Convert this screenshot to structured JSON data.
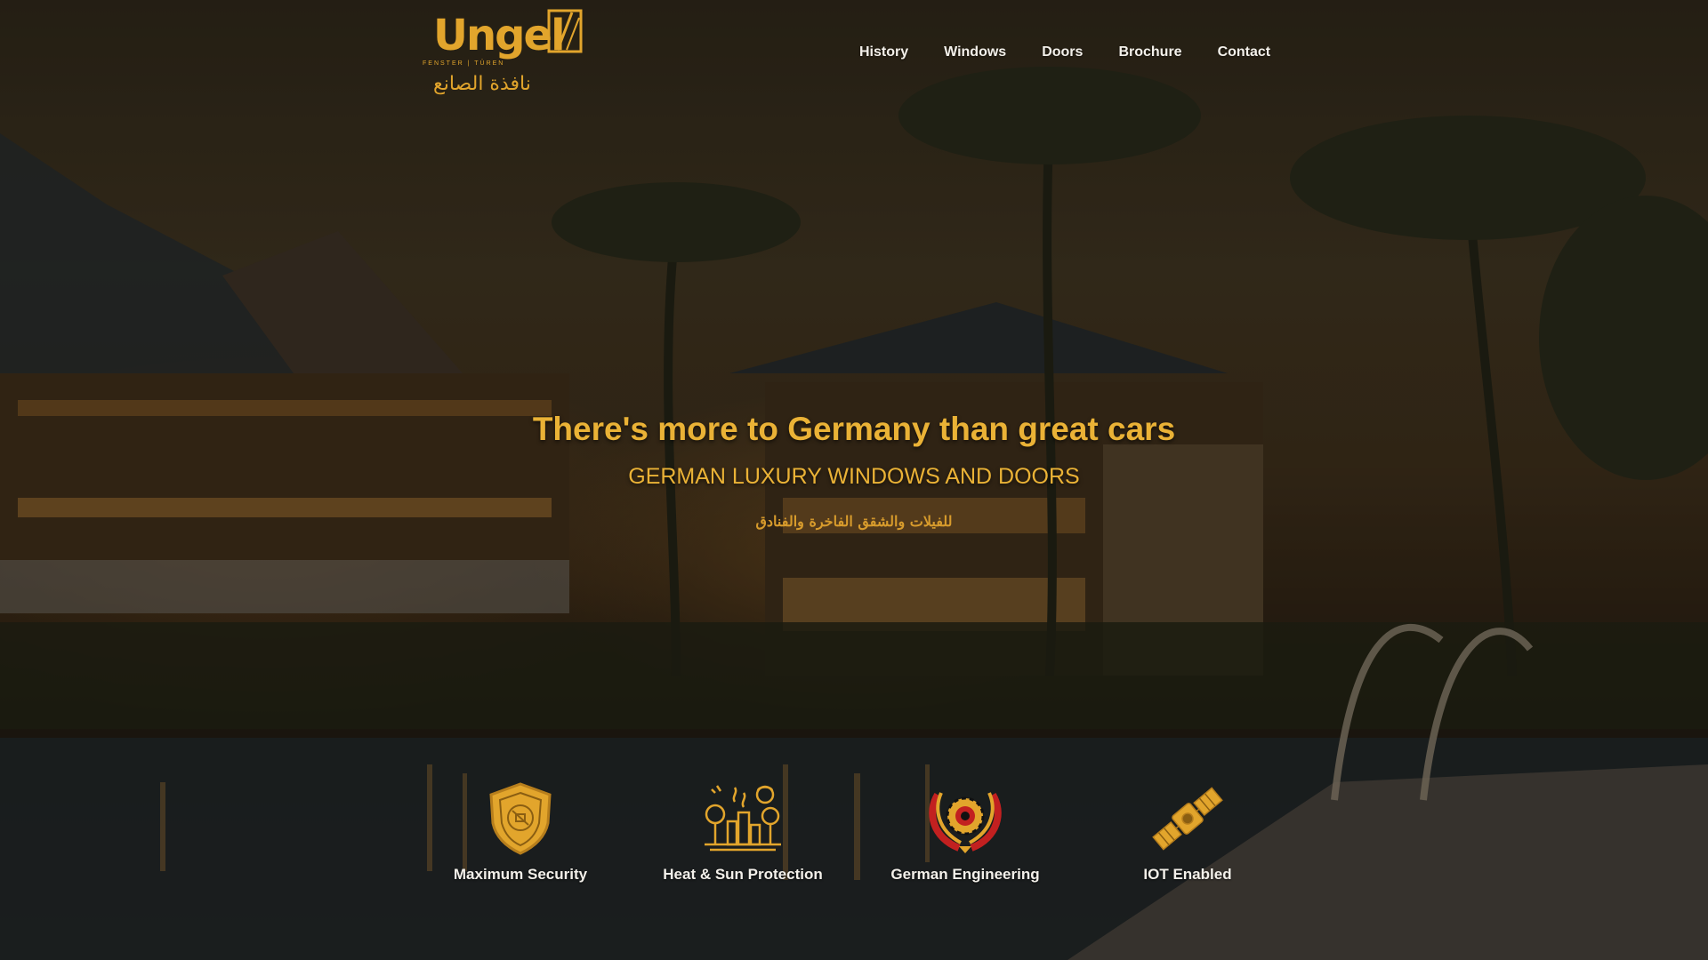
{
  "brand": {
    "logo_text": "Ungel",
    "tagline": "FENSTER | TÜREN",
    "arabic_name": "نافذة الصانع",
    "accent_color": "#e2a52c"
  },
  "nav": {
    "items": [
      {
        "label": "History"
      },
      {
        "label": "Windows"
      },
      {
        "label": "Doors"
      },
      {
        "label": "Brochure"
      },
      {
        "label": "Contact"
      }
    ]
  },
  "hero": {
    "title": "There's more to Germany than great cars",
    "subtitle": "GERMAN LUXURY WINDOWS AND DOORS",
    "arabic_subtitle": "للفيلات والشقق الفاخرة والفنادق",
    "text_color": "#eab236"
  },
  "features": [
    {
      "label": "Maximum Security",
      "icon": "shield-icon"
    },
    {
      "label": "Heat & Sun Protection",
      "icon": "city-sun-icon"
    },
    {
      "label": "German Engineering",
      "icon": "gear-wreath-icon"
    },
    {
      "label": "IOT Enabled",
      "icon": "satellite-icon"
    }
  ]
}
